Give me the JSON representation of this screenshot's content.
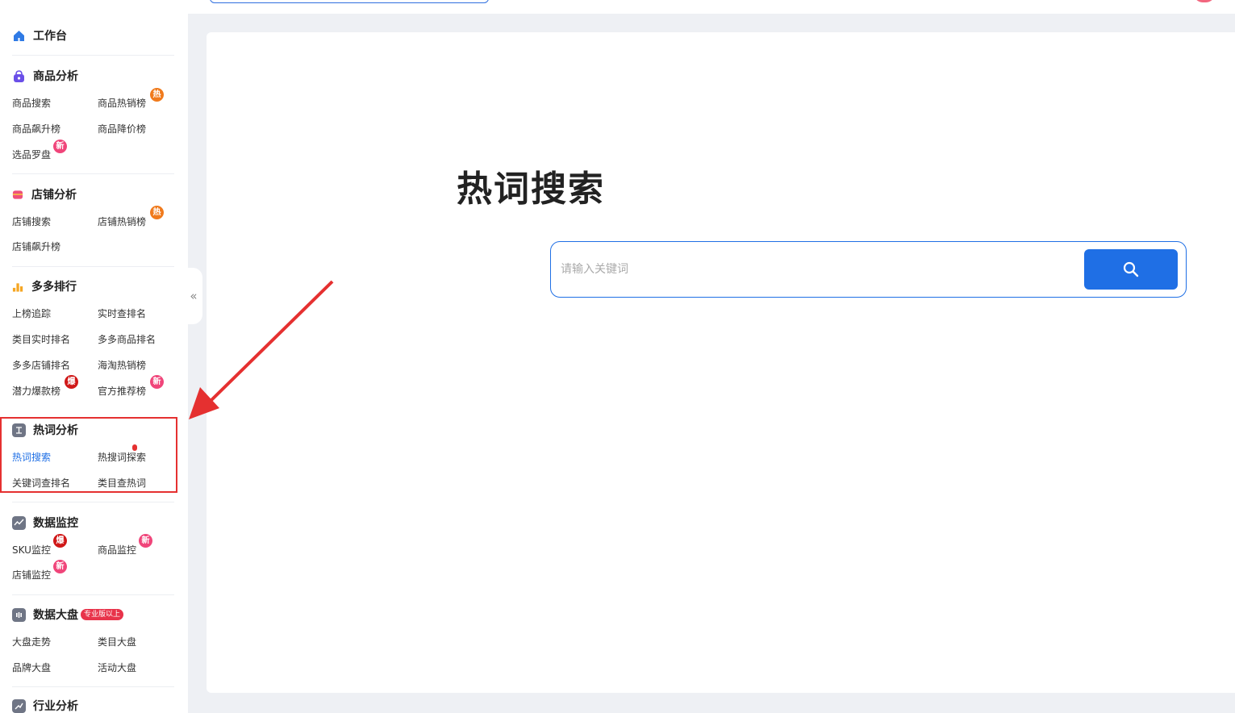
{
  "colors": {
    "accent": "#1f6fe5",
    "annotation": "#e53030",
    "hot_badge": "#f07a1c",
    "new_badge": "#f0457a",
    "boom_badge": "#d01818"
  },
  "sidebar": {
    "workbench": {
      "label": "工作台",
      "icon": "home-icon"
    },
    "product_analysis": {
      "title": "商品分析",
      "icon": "shopping-bag-icon",
      "items": [
        "商品搜索",
        "商品热销榜",
        "商品飙升榜",
        "商品降价榜",
        "选品罗盘"
      ]
    },
    "shop_analysis": {
      "title": "店铺分析",
      "icon": "shop-icon",
      "items": [
        "店铺搜索",
        "店铺热销榜",
        "店铺飙升榜"
      ]
    },
    "ranking": {
      "title": "多多排行",
      "icon": "bar-chart-icon",
      "items": [
        "上榜追踪",
        "实时查排名",
        "类目实时排名",
        "多多商品排名",
        "多多店铺排名",
        "海淘热销榜",
        "潜力爆款榜",
        "官方推荐榜"
      ]
    },
    "keyword_analysis": {
      "title": "热词分析",
      "icon": "keyword-icon",
      "items": [
        "热词搜索",
        "热搜词探索",
        "关键词查排名",
        "类目查热词"
      ]
    },
    "monitoring": {
      "title": "数据监控",
      "icon": "monitor-icon",
      "items": [
        "SKU监控",
        "商品监控",
        "店铺监控"
      ]
    },
    "market": {
      "title": "数据大盘",
      "icon": "dashboard-icon",
      "tag": "专业版以上",
      "items": [
        "大盘走势",
        "类目大盘",
        "品牌大盘",
        "活动大盘"
      ]
    },
    "industry": {
      "title": "行业分析",
      "icon": "industry-icon"
    },
    "badges": {
      "hot": "热",
      "new": "新",
      "boom": "爆"
    }
  },
  "main": {
    "title": "热词搜索",
    "search": {
      "placeholder": "请输入关键词",
      "value": ""
    }
  }
}
